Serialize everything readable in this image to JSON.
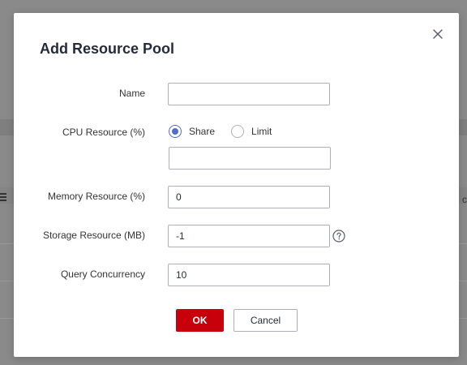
{
  "dialog": {
    "title": "Add Resource Pool"
  },
  "form": {
    "name": {
      "label": "Name",
      "value": ""
    },
    "cpu_resource": {
      "label": "CPU Resource (%)",
      "options": [
        {
          "label": "Share",
          "selected": true
        },
        {
          "label": "Limit",
          "selected": false
        }
      ],
      "value": ""
    },
    "memory_resource": {
      "label": "Memory Resource (%)",
      "value": "0"
    },
    "storage_resource": {
      "label": "Storage Resource (MB)",
      "value": "-1",
      "help_icon": "question-circle-icon"
    },
    "query_concurrency": {
      "label": "Query Concurrency",
      "value": "10"
    }
  },
  "actions": {
    "ok_label": "OK",
    "cancel_label": "Cancel"
  },
  "colors": {
    "primary_button": "#c7000b",
    "radio_selected": "#526ecc",
    "overlay": "#8a8a8a"
  }
}
